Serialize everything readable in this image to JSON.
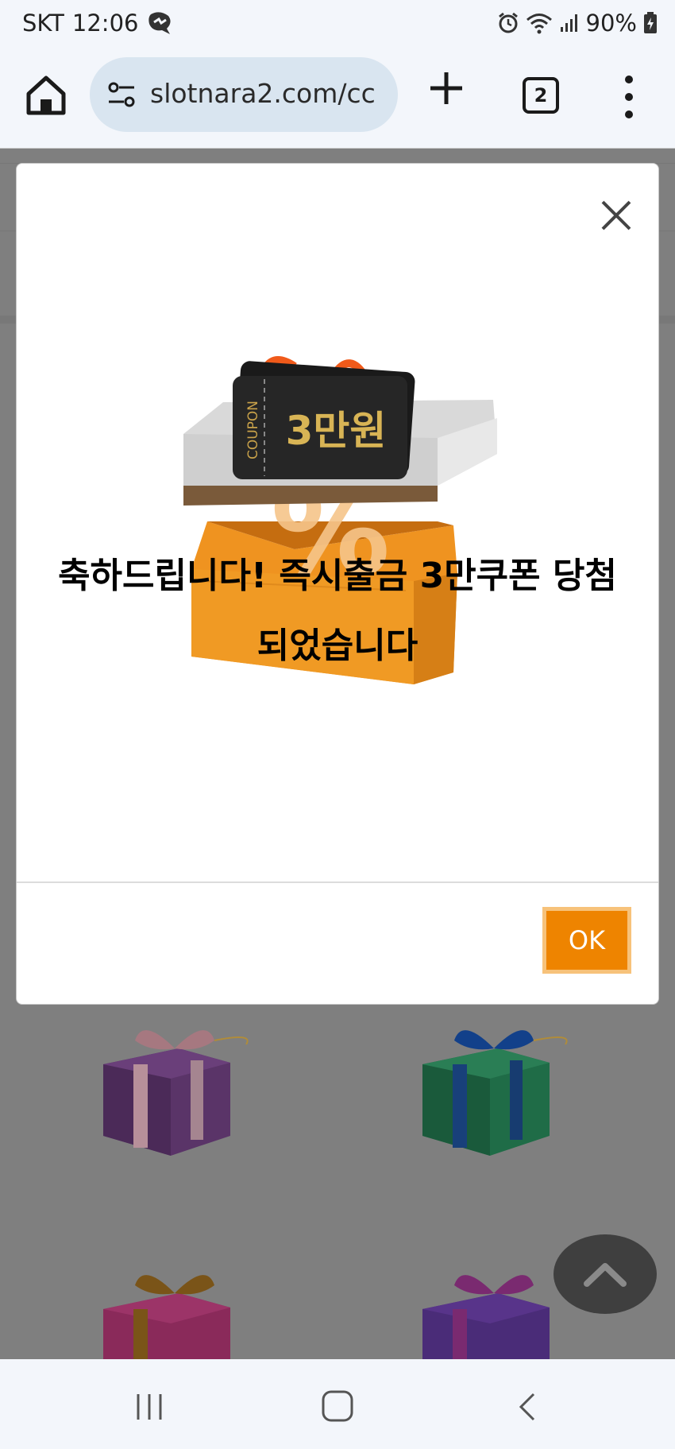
{
  "status_bar": {
    "carrier": "SKT",
    "time": "12:06",
    "battery": "90%"
  },
  "browser": {
    "url": "slotnara2.com/cc",
    "tab_count": "2"
  },
  "popup": {
    "coupon_label": "COUPON",
    "coupon_amount": "3만원",
    "message_line1": "축하드립니다! 즉시출금 3만쿠폰 당첨",
    "message_line2": "되었습니다",
    "ok_label": "OK"
  },
  "colors": {
    "ok_button": "#ee8400",
    "ok_border": "#f7c27a",
    "overlay": "#808080"
  }
}
